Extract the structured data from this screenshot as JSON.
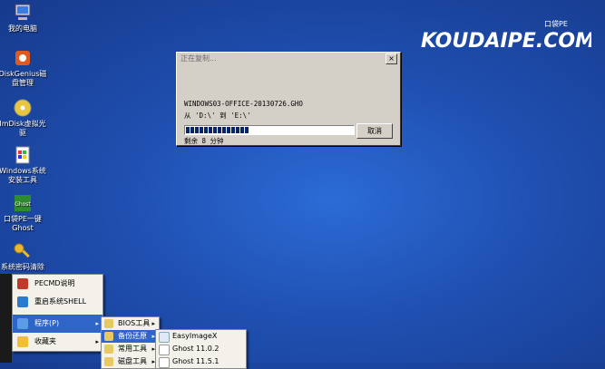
{
  "desktop": {
    "icons": [
      {
        "label": "我的电脑",
        "icon": "computer-icon"
      },
      {
        "label": "DiskGenius磁盘管理",
        "icon": "diskgenius-icon"
      },
      {
        "label": "ImDisk虚拟光驱",
        "icon": "cd-icon"
      },
      {
        "label": "Windows系统安装工具",
        "icon": "windows-install-icon"
      },
      {
        "label": "口袋PE一键Ghost",
        "icon": "ghost-icon"
      },
      {
        "label": "系统密码清除",
        "icon": "key-icon"
      }
    ],
    "brand": {
      "text": "KOUDAIPE.COM",
      "small": "口袋PE"
    }
  },
  "dialog": {
    "title": "正在复制...",
    "close": "×",
    "filename": "WINDOWS03-OFFICE-20130726.GHO",
    "from_to": "从 'D:\\' 到 'E:\\'",
    "remaining": "剩余 8 分钟",
    "progress": 0.38,
    "cancel": "取消"
  },
  "start_menu": {
    "items": [
      {
        "label": "PECMD说明",
        "icon": "pecmd-icon"
      },
      {
        "label": "重启系统SHELL",
        "icon": "restart-shell-icon"
      },
      {
        "label": "程序(P)",
        "icon": "programs-icon",
        "arrow": "▸"
      },
      {
        "label": "收藏夹",
        "icon": "favorites-icon",
        "arrow": "▸"
      }
    ]
  },
  "programs_menu": {
    "items": [
      {
        "label": "BIOS工具",
        "arrow": "▸"
      },
      {
        "label": "备份还原",
        "arrow": "▸"
      },
      {
        "label": "常用工具",
        "arrow": "▸"
      },
      {
        "label": "磁盘工具",
        "arrow": "▸"
      }
    ]
  },
  "backup_menu": {
    "items": [
      {
        "label": "EasyImageX"
      },
      {
        "label": "Ghost 11.0.2"
      },
      {
        "label": "Ghost 11.5.1"
      }
    ]
  }
}
